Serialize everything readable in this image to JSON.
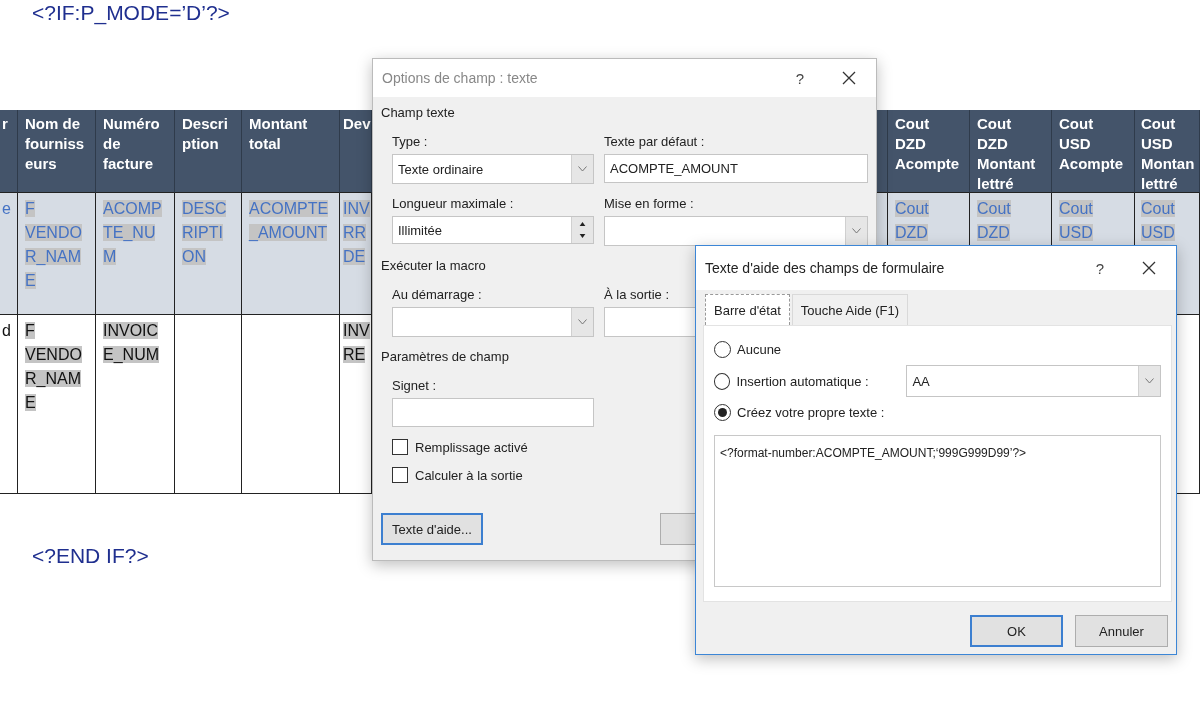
{
  "document": {
    "heading": "<?IF:P_MODE=’D’?>",
    "footer": "<?END IF?>",
    "table": {
      "columns": [
        "r",
        "Nom de fournisseurs",
        "Numéro de facture",
        "Description",
        "Montant total",
        "Dev",
        "Cout DZD Acompte",
        "Cout DZD Montant lettré",
        "Cout USD Acompte",
        "Cout USD Montan lettré"
      ],
      "rows": [
        {
          "shaded": true,
          "cells": [
            "e",
            "F VENDOR_NAME",
            "ACOMPTE_NUM",
            "DESCRIPTION",
            "ACOMPTE_AMOUNT",
            "INV RR DE",
            "Cout DZD",
            "Cout DZD",
            "Cout USD",
            "Cout USD"
          ]
        },
        {
          "shaded": false,
          "cells": [
            "d",
            "F VENDOR_NAME",
            "INVOICE_NUM",
            null,
            null,
            "INV RE",
            null,
            null,
            null,
            null
          ]
        }
      ]
    }
  },
  "field_options": {
    "title": "Options de champ : texte",
    "help": "?",
    "sections": [
      {
        "heading": "Champ texte",
        "fields": [
          {
            "kind": "combo",
            "label": "Type :",
            "value": "Texte ordinaire"
          },
          {
            "kind": "text",
            "label": "Texte par défaut :",
            "value": "ACOMPTE_AMOUNT"
          },
          {
            "kind": "spin",
            "label": "Longueur maximale :",
            "value": "Illimitée"
          },
          {
            "kind": "combo",
            "label": "Mise en forme :"
          }
        ]
      },
      {
        "heading": "Exécuter la macro",
        "fields": [
          {
            "kind": "combo",
            "label": "Au démarrage :"
          },
          {
            "kind": "combo",
            "label": "À la sortie :"
          }
        ]
      },
      {
        "heading": "Paramètres de champ",
        "fields": [
          {
            "kind": "text",
            "label": "Signet :"
          },
          {
            "kind": "checkbox",
            "label": "Remplissage activé",
            "checked": false
          },
          {
            "kind": "checkbox",
            "label": "Calculer à la sortie",
            "checked": false
          }
        ]
      }
    ],
    "buttons": [
      {
        "label": "Texte d'aide...",
        "focused": true
      },
      {
        "focused": false
      }
    ]
  },
  "help_text": {
    "title": "Texte d'aide des champs de formulaire",
    "help": "?",
    "tabs": [
      {
        "label": "Barre d'état",
        "selected": true
      },
      {
        "label": "Touche Aide (F1)",
        "selected": false
      }
    ],
    "options": [
      {
        "label": "Aucune",
        "selected": false
      },
      {
        "label": "Insertion automatique :",
        "selected": false,
        "combo": "AA"
      },
      {
        "label": "Créez votre propre texte :",
        "selected": true
      }
    ],
    "text": "<?format-number:ACOMPTE_AMOUNT;‘999G999D99’?>",
    "buttons": [
      {
        "label": "OK",
        "default": true
      },
      {
        "label": "Annuler",
        "default": false
      }
    ]
  }
}
